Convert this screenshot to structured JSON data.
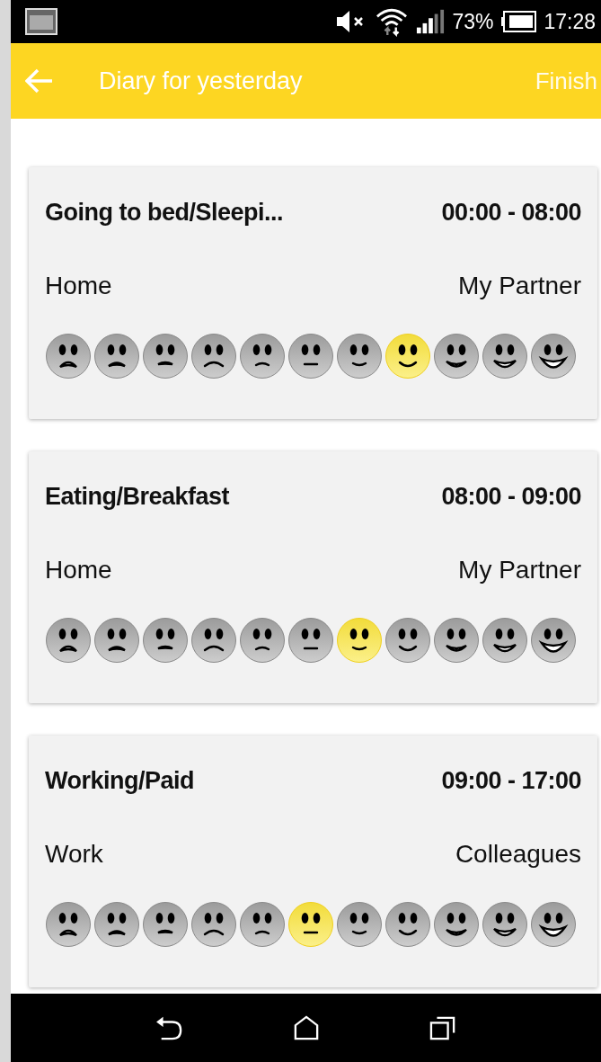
{
  "status_bar": {
    "battery": "73%",
    "time": "17:28"
  },
  "header": {
    "title": "Diary for yesterday",
    "action": {
      "label": "Finish",
      "disabled": true
    }
  },
  "entries": [
    {
      "activity": "Going to bed/Sleepi...",
      "time": "00:00 - 08:00",
      "place": "Home",
      "company": "My Partner",
      "faces": [
        {
          "selected": false
        },
        {
          "selected": false
        },
        {
          "selected": false
        },
        {
          "selected": false
        },
        {
          "selected": false
        },
        {
          "selected": false
        },
        {
          "selected": false
        },
        {
          "selected": true
        },
        {
          "selected": false
        },
        {
          "selected": false
        },
        {
          "selected": false
        }
      ]
    },
    {
      "activity": "Eating/Breakfast",
      "time": "08:00 - 09:00",
      "place": "Home",
      "company": "My Partner",
      "faces": [
        {
          "selected": false
        },
        {
          "selected": false
        },
        {
          "selected": false
        },
        {
          "selected": false
        },
        {
          "selected": false
        },
        {
          "selected": false
        },
        {
          "selected": true
        },
        {
          "selected": false
        },
        {
          "selected": false
        },
        {
          "selected": false
        },
        {
          "selected": false
        }
      ]
    },
    {
      "activity": "Working/Paid",
      "time": "09:00 - 17:00",
      "place": "Work",
      "company": "Colleagues",
      "faces": [
        {
          "selected": false
        },
        {
          "selected": false
        },
        {
          "selected": false
        },
        {
          "selected": false
        },
        {
          "selected": false
        },
        {
          "selected": true
        },
        {
          "selected": false
        },
        {
          "selected": false
        },
        {
          "selected": false
        },
        {
          "selected": false
        },
        {
          "selected": false
        }
      ]
    }
  ]
}
